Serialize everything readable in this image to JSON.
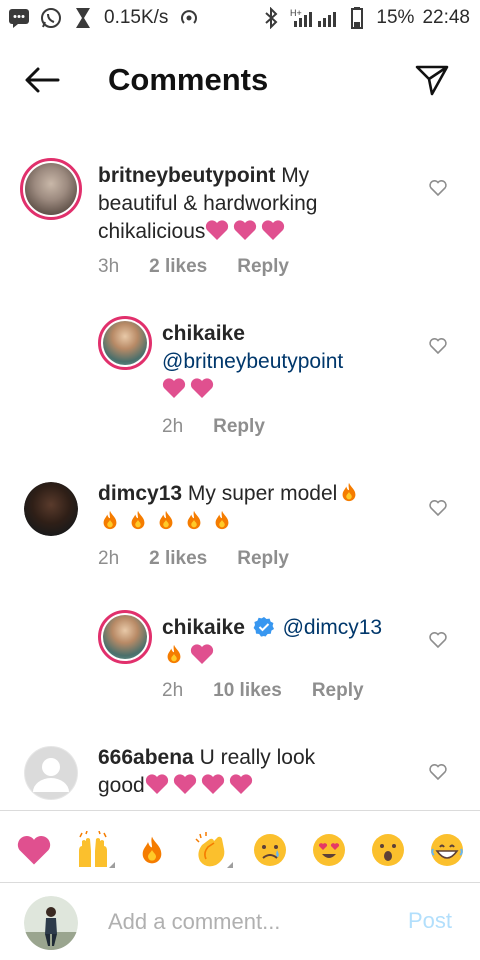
{
  "status_bar": {
    "speed": "0.15K/s",
    "network": "H+",
    "battery": "15%",
    "time": "22:48"
  },
  "header": {
    "title": "Comments"
  },
  "comments": [
    {
      "username": "britneybeutypoint",
      "text_lines": [
        "My",
        "beautiful & hardworking",
        "chikalicious"
      ],
      "trailing_emoji": [
        "pink-heart",
        "pink-heart",
        "pink-heart"
      ],
      "time": "3h",
      "likes": "2 likes",
      "reply": "Reply"
    },
    {
      "username": "chikaike",
      "mention": "@britneybeutypoint",
      "trailing_emoji": [
        "pink-heart",
        "pink-heart"
      ],
      "time": "2h",
      "reply": "Reply"
    },
    {
      "username": "dimcy13",
      "text": "My super model",
      "trailing_emoji": [
        "fire",
        "fire",
        "fire",
        "fire",
        "fire",
        "fire"
      ],
      "time": "2h",
      "likes": "2 likes",
      "reply": "Reply"
    },
    {
      "username": "chikaike",
      "verified": true,
      "mention": "@dimcy13",
      "trailing_emoji": [
        "fire",
        "pink-heart"
      ],
      "time": "2h",
      "likes": "10 likes",
      "reply": "Reply"
    },
    {
      "username": "666abena",
      "text_lines": [
        "U really look",
        "good"
      ],
      "trailing_emoji": [
        "pink-heart",
        "pink-heart",
        "pink-heart",
        "pink-heart"
      ]
    }
  ],
  "emoji_bar": [
    "heart-emoji",
    "raised-hands-emoji",
    "fire-emoji",
    "clapping-hands-emoji",
    "sad-face-emoji",
    "heart-eyes-emoji",
    "surprised-face-emoji",
    "grinning-face-emoji"
  ],
  "input": {
    "placeholder": "Add a comment...",
    "post_label": "Post"
  },
  "colors": {
    "pink_heart": "#e0508f",
    "mention": "#00376b",
    "post_disabled": "#b2dffc",
    "muted": "#8e8e8e"
  }
}
